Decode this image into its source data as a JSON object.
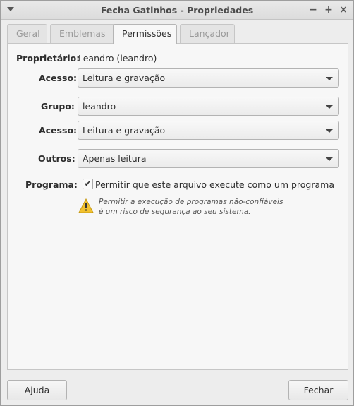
{
  "window": {
    "title": "Fecha Gatinhos - Propriedades",
    "minimize_glyph": "−",
    "maximize_glyph": "+",
    "close_glyph": "×"
  },
  "tabs": [
    {
      "label": "Geral",
      "active": false
    },
    {
      "label": "Emblemas",
      "active": false
    },
    {
      "label": "Permissões",
      "active": true
    },
    {
      "label": "Lançador",
      "active": false
    }
  ],
  "permissions": {
    "owner_label": "Proprietário:",
    "owner_value": "Leandro (leandro)",
    "owner_access_label": "Acesso:",
    "owner_access_value": "Leitura e gravação",
    "group_label": "Grupo:",
    "group_value": "leandro",
    "group_access_label": "Acesso:",
    "group_access_value": "Leitura e gravação",
    "others_label": "Outros:",
    "others_value": "Apenas leitura",
    "program_label": "Programa:",
    "program_checkbox_label": "Permitir que este arquivo execute como um programa",
    "program_checked": true,
    "warning_line1": "Permitir a execução de programas não-confiáveis",
    "warning_line2": "é um risco de segurança ao seu sistema."
  },
  "buttons": {
    "help": "Ajuda",
    "close": "Fechar"
  },
  "icons": {
    "checkmark": "✔",
    "warning": "warning-icon"
  },
  "colors": {
    "window_bg": "#ededed",
    "warning_yellow": "#f2c12e"
  }
}
